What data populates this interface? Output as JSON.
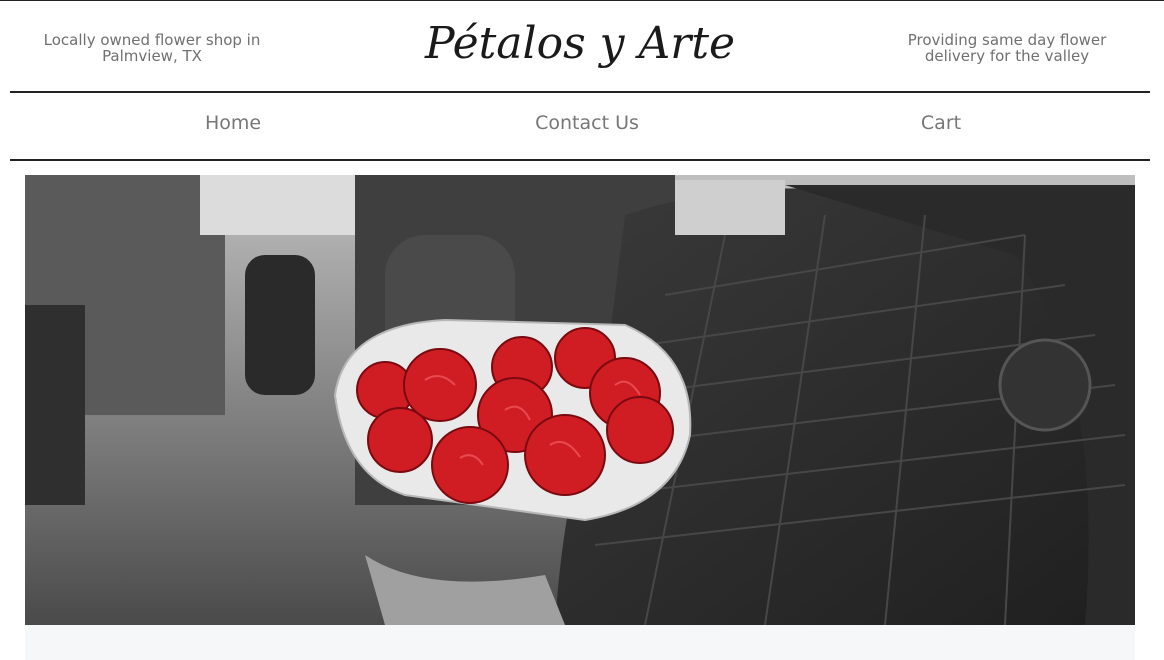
{
  "header": {
    "tagline_left": "Locally owned flower shop in Palmview, TX",
    "logo_text": "Pétalos y Arte",
    "tagline_right": "Providing same day flower delivery for the valley"
  },
  "nav": {
    "items": [
      "Home",
      "Contact Us",
      "Cart"
    ]
  },
  "hero": {
    "image": "man-holding-red-roses-bouquet"
  },
  "colors": {
    "rose": "#d01d24",
    "text": "#707070",
    "rule": "#222222",
    "footer_bg": "#f6f7f8"
  }
}
